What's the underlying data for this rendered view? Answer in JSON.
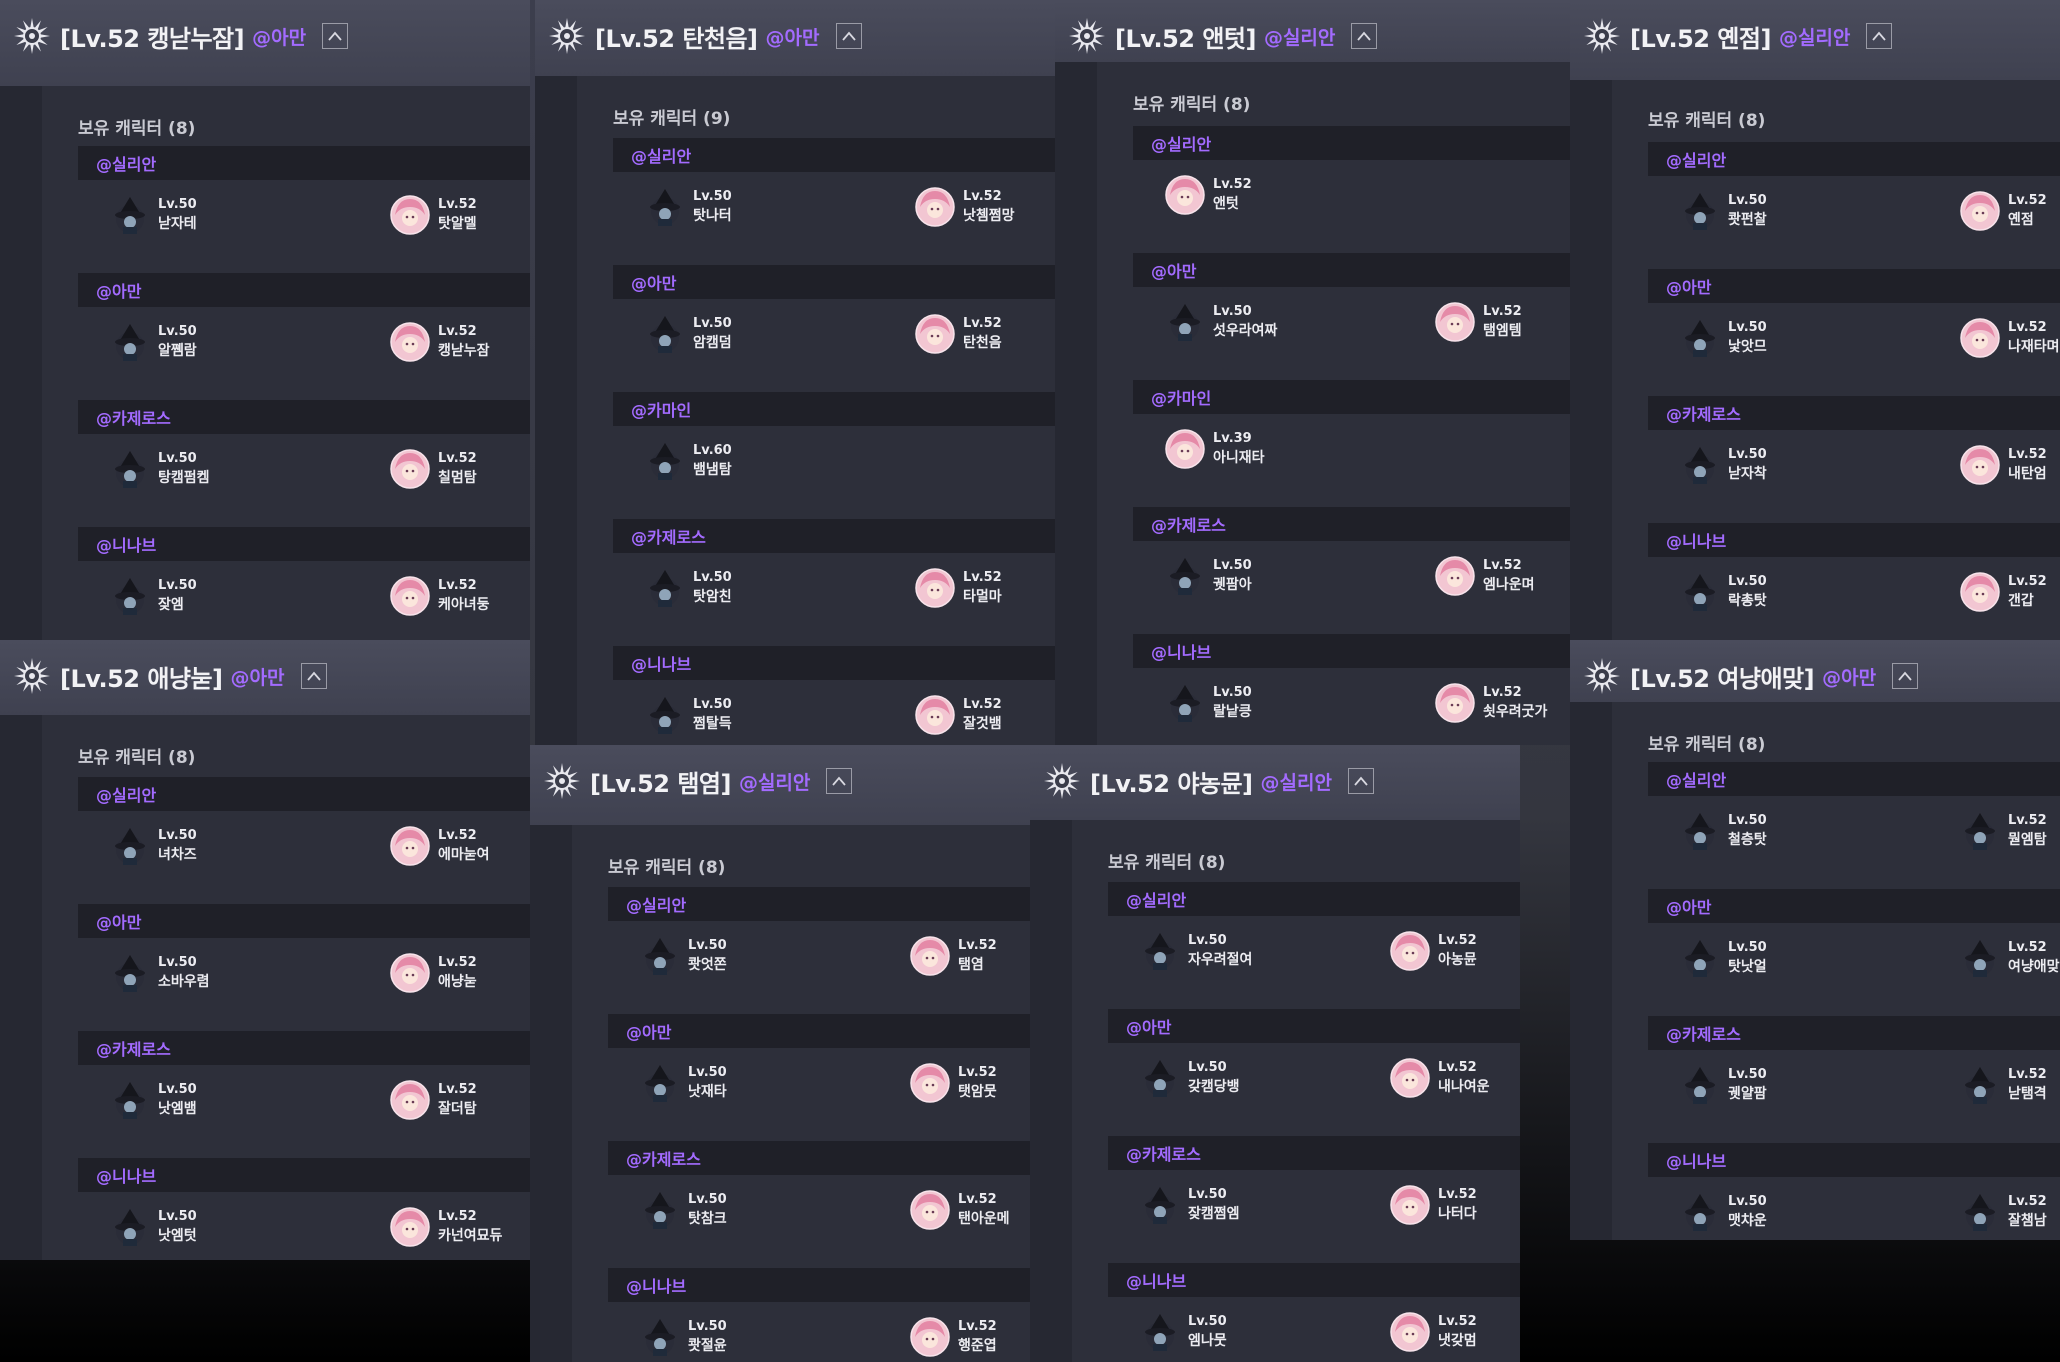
{
  "count_label": "보유 캐릭터",
  "icons": {
    "emblem": "guild-emblem-icon",
    "collapse": "chevron-up-icon",
    "avatar_a": "witch-hat-avatar-icon",
    "avatar_b": "pink-hair-avatar-icon"
  },
  "colors": {
    "accent": "#a36bff",
    "row_bg": "#1f2028",
    "panel_bg": "#2d2f3a"
  },
  "panels": [
    {
      "guild_name": "[Lv.52 캥낟누잠]",
      "owner": "@아만",
      "count": "(8)",
      "servers": [
        {
          "name": "@실리안",
          "chars": [
            {
              "level": "Lv.50",
              "name": "낟자테",
              "avatar": "a"
            },
            {
              "level": "Lv.52",
              "name": "탓알멜",
              "avatar": "b"
            }
          ]
        },
        {
          "name": "@아만",
          "chars": [
            {
              "level": "Lv.50",
              "name": "알쪰람",
              "avatar": "a"
            },
            {
              "level": "Lv.52",
              "name": "캥낟누잠",
              "avatar": "b"
            }
          ]
        },
        {
          "name": "@카제로스",
          "chars": [
            {
              "level": "Lv.50",
              "name": "탕캠펌켐",
              "avatar": "a"
            },
            {
              "level": "Lv.52",
              "name": "칠멈탐",
              "avatar": "b"
            }
          ]
        },
        {
          "name": "@니나브",
          "chars": [
            {
              "level": "Lv.50",
              "name": "잦엠",
              "avatar": "a"
            },
            {
              "level": "Lv.52",
              "name": "케아녀둥",
              "avatar": "b"
            }
          ]
        }
      ]
    },
    {
      "guild_name": "[Lv.52 탄천음]",
      "owner": "@아만",
      "count": "(9)",
      "servers": [
        {
          "name": "@실리안",
          "chars": [
            {
              "level": "Lv.50",
              "name": "탓나터",
              "avatar": "a"
            },
            {
              "level": "Lv.52",
              "name": "낫쳄쩜망",
              "avatar": "b"
            }
          ]
        },
        {
          "name": "@아만",
          "chars": [
            {
              "level": "Lv.50",
              "name": "암캠덤",
              "avatar": "a"
            },
            {
              "level": "Lv.52",
              "name": "탄천음",
              "avatar": "b"
            }
          ]
        },
        {
          "name": "@카마인",
          "chars": [
            {
              "level": "Lv.60",
              "name": "뱀냄탐",
              "avatar": "a"
            }
          ]
        },
        {
          "name": "@카제로스",
          "chars": [
            {
              "level": "Lv.50",
              "name": "탓암친",
              "avatar": "a"
            },
            {
              "level": "Lv.52",
              "name": "타멀마",
              "avatar": "b"
            }
          ]
        },
        {
          "name": "@니나브",
          "chars": [
            {
              "level": "Lv.50",
              "name": "쩜탈득",
              "avatar": "a"
            },
            {
              "level": "Lv.52",
              "name": "잘것뱀",
              "avatar": "b"
            }
          ]
        }
      ]
    },
    {
      "guild_name": "[Lv.52 앤텃]",
      "owner": "@실리안",
      "count": "(8)",
      "servers": [
        {
          "name": "@실리안",
          "chars": [
            {
              "level": "Lv.52",
              "name": "앤텃",
              "avatar": "b"
            }
          ]
        },
        {
          "name": "@아만",
          "chars": [
            {
              "level": "Lv.50",
              "name": "섯우라여짜",
              "avatar": "a"
            },
            {
              "level": "Lv.52",
              "name": "탬엠템",
              "avatar": "b"
            }
          ]
        },
        {
          "name": "@카마인",
          "chars": [
            {
              "level": "Lv.39",
              "name": "아니재타",
              "avatar": "b"
            }
          ]
        },
        {
          "name": "@카제로스",
          "chars": [
            {
              "level": "Lv.50",
              "name": "궷팜아",
              "avatar": "a"
            },
            {
              "level": "Lv.52",
              "name": "엠나운며",
              "avatar": "b"
            }
          ]
        },
        {
          "name": "@니나브",
          "chars": [
            {
              "level": "Lv.50",
              "name": "랄낱킁",
              "avatar": "a"
            },
            {
              "level": "Lv.52",
              "name": "쇳우려굿가",
              "avatar": "b"
            }
          ]
        }
      ]
    },
    {
      "guild_name": "[Lv.52 옌점]",
      "owner": "@실리안",
      "count": "(8)",
      "servers": [
        {
          "name": "@실리안",
          "chars": [
            {
              "level": "Lv.50",
              "name": "쾃펀찰",
              "avatar": "a"
            },
            {
              "level": "Lv.52",
              "name": "옌점",
              "avatar": "b"
            }
          ]
        },
        {
          "name": "@아만",
          "chars": [
            {
              "level": "Lv.50",
              "name": "낯앗므",
              "avatar": "a"
            },
            {
              "level": "Lv.52",
              "name": "나재타며",
              "avatar": "b"
            }
          ]
        },
        {
          "name": "@카제로스",
          "chars": [
            {
              "level": "Lv.50",
              "name": "낟자착",
              "avatar": "a"
            },
            {
              "level": "Lv.52",
              "name": "내탄엄",
              "avatar": "b"
            }
          ]
        },
        {
          "name": "@니나브",
          "chars": [
            {
              "level": "Lv.50",
              "name": "락총탓",
              "avatar": "a"
            },
            {
              "level": "Lv.52",
              "name": "갠갑",
              "avatar": "b"
            }
          ]
        }
      ]
    },
    {
      "guild_name": "[Lv.52 애냥눋]",
      "owner": "@아만",
      "count": "(8)",
      "servers": [
        {
          "name": "@실리안",
          "chars": [
            {
              "level": "Lv.50",
              "name": "녀차즈",
              "avatar": "a"
            },
            {
              "level": "Lv.52",
              "name": "에마눋여",
              "avatar": "b"
            }
          ]
        },
        {
          "name": "@아만",
          "chars": [
            {
              "level": "Lv.50",
              "name": "소바우렴",
              "avatar": "a"
            },
            {
              "level": "Lv.52",
              "name": "애냥눋",
              "avatar": "b"
            }
          ]
        },
        {
          "name": "@카제로스",
          "chars": [
            {
              "level": "Lv.50",
              "name": "낫엠뱀",
              "avatar": "a"
            },
            {
              "level": "Lv.52",
              "name": "잘더탐",
              "avatar": "b"
            }
          ]
        },
        {
          "name": "@니나브",
          "chars": [
            {
              "level": "Lv.50",
              "name": "낫엠텃",
              "avatar": "a"
            },
            {
              "level": "Lv.52",
              "name": "카넌여묘듀",
              "avatar": "b"
            }
          ]
        }
      ]
    },
    {
      "guild_name": "[Lv.52 탬염]",
      "owner": "@실리안",
      "count": "(8)",
      "servers": [
        {
          "name": "@실리안",
          "chars": [
            {
              "level": "Lv.50",
              "name": "쾃엇쫀",
              "avatar": "a"
            },
            {
              "level": "Lv.52",
              "name": "탬염",
              "avatar": "b"
            }
          ]
        },
        {
          "name": "@아만",
          "chars": [
            {
              "level": "Lv.50",
              "name": "낫재타",
              "avatar": "a"
            },
            {
              "level": "Lv.52",
              "name": "탯암뭇",
              "avatar": "b"
            }
          ]
        },
        {
          "name": "@카제로스",
          "chars": [
            {
              "level": "Lv.50",
              "name": "탓참크",
              "avatar": "a"
            },
            {
              "level": "Lv.52",
              "name": "탠아운메",
              "avatar": "b"
            }
          ]
        },
        {
          "name": "@니나브",
          "chars": [
            {
              "level": "Lv.50",
              "name": "쾃절윤",
              "avatar": "a"
            },
            {
              "level": "Lv.52",
              "name": "행준엽",
              "avatar": "b"
            }
          ]
        }
      ]
    },
    {
      "guild_name": "[Lv.52 야농뮨]",
      "owner": "@실리안",
      "count": "(8)",
      "servers": [
        {
          "name": "@실리안",
          "chars": [
            {
              "level": "Lv.50",
              "name": "자우려절여",
              "avatar": "a"
            },
            {
              "level": "Lv.52",
              "name": "아농뮨",
              "avatar": "b"
            }
          ]
        },
        {
          "name": "@아만",
          "chars": [
            {
              "level": "Lv.50",
              "name": "갖캠당뱅",
              "avatar": "a"
            },
            {
              "level": "Lv.52",
              "name": "내나여운",
              "avatar": "b"
            }
          ]
        },
        {
          "name": "@카제로스",
          "chars": [
            {
              "level": "Lv.50",
              "name": "잦캠쩜엠",
              "avatar": "a"
            },
            {
              "level": "Lv.52",
              "name": "나터다",
              "avatar": "b"
            }
          ]
        },
        {
          "name": "@니나브",
          "chars": [
            {
              "level": "Lv.50",
              "name": "엠나뭇",
              "avatar": "a"
            },
            {
              "level": "Lv.52",
              "name": "냇갖멈",
              "avatar": "b"
            }
          ]
        }
      ]
    },
    {
      "guild_name": "[Lv.52 여냥애맞]",
      "owner": "@아만",
      "count": "(8)",
      "servers": [
        {
          "name": "@실리안",
          "chars": [
            {
              "level": "Lv.50",
              "name": "철층탓",
              "avatar": "a"
            },
            {
              "level": "Lv.52",
              "name": "뭗엠탐",
              "avatar": "a"
            }
          ]
        },
        {
          "name": "@아만",
          "chars": [
            {
              "level": "Lv.50",
              "name": "탓낫얼",
              "avatar": "a"
            },
            {
              "level": "Lv.52",
              "name": "여냥애맞",
              "avatar": "a"
            }
          ]
        },
        {
          "name": "@카제로스",
          "chars": [
            {
              "level": "Lv.50",
              "name": "궷얄팜",
              "avatar": "a"
            },
            {
              "level": "Lv.52",
              "name": "낟탬격",
              "avatar": "a"
            }
          ]
        },
        {
          "name": "@니나브",
          "chars": [
            {
              "level": "Lv.50",
              "name": "맷챠운",
              "avatar": "a"
            },
            {
              "level": "Lv.52",
              "name": "잘챔남",
              "avatar": "a"
            }
          ]
        }
      ]
    }
  ]
}
